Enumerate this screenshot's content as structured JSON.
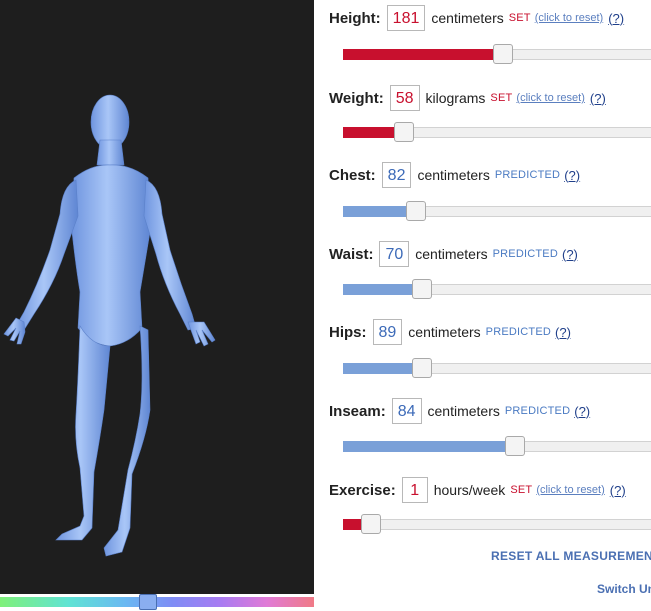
{
  "measurements": [
    {
      "key": "height",
      "label": "Height:",
      "value": "181",
      "unit": "centimeters",
      "status": "SET",
      "reset": "(click to reset)",
      "help": "(?)",
      "fraction": 0.5
    },
    {
      "key": "weight",
      "label": "Weight:",
      "value": "58",
      "unit": "kilograms",
      "status": "SET",
      "reset": "(click to reset)",
      "help": "(?)",
      "fraction": 0.17
    },
    {
      "key": "chest",
      "label": "Chest:",
      "value": "82",
      "unit": "centimeters",
      "status": "PREDICTED",
      "reset": "",
      "help": "(?)",
      "fraction": 0.21
    },
    {
      "key": "waist",
      "label": "Waist:",
      "value": "70",
      "unit": "centimeters",
      "status": "PREDICTED",
      "reset": "",
      "help": "(?)",
      "fraction": 0.23
    },
    {
      "key": "hips",
      "label": "Hips:",
      "value": "89",
      "unit": "centimeters",
      "status": "PREDICTED",
      "reset": "",
      "help": "(?)",
      "fraction": 0.23
    },
    {
      "key": "inseam",
      "label": "Inseam:",
      "value": "84",
      "unit": "centimeters",
      "status": "PREDICTED",
      "reset": "",
      "help": "(?)",
      "fraction": 0.54
    },
    {
      "key": "exercise",
      "label": "Exercise:",
      "value": "1",
      "unit": "hours/week",
      "status": "SET",
      "reset": "(click to reset)",
      "help": "(?)",
      "fraction": 0.06
    }
  ],
  "reset_all": "RESET ALL MEASUREMENTS",
  "switch_units": "Switch Units",
  "color_slider_fraction": 0.47,
  "colors": {
    "set": "#c8102e",
    "predicted": "#7aa0d8",
    "viewer_bg": "#1e1e1e",
    "body": "#8fb4f2"
  }
}
